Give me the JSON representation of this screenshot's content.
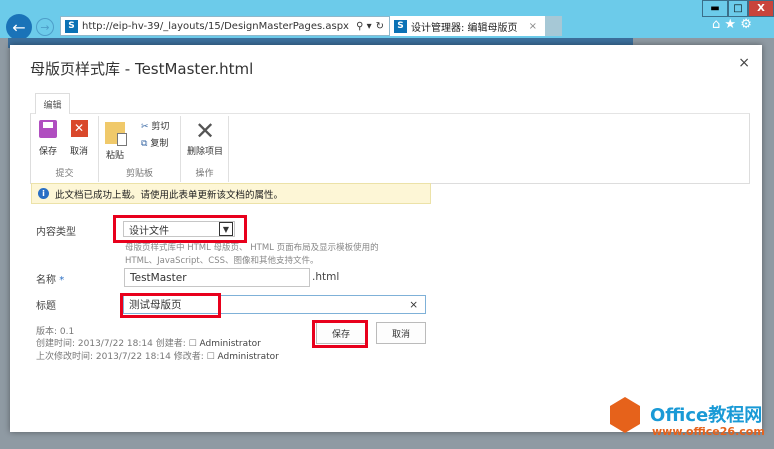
{
  "browser": {
    "url": "http://eip-hv-39/_layouts/15/DesignMasterPages.aspx",
    "url_host": "eip-hv-39",
    "tab_title": "设计管理器: 编辑母版页",
    "window_buttons": {
      "minimize": "▬",
      "maximize": "□",
      "close": "X"
    }
  },
  "dialog": {
    "title": "母版页样式库 - TestMaster.html",
    "close": "×"
  },
  "ribbon": {
    "tab": "编辑",
    "groups": [
      {
        "label": "提交",
        "buttons": [
          "保存",
          "取消"
        ]
      },
      {
        "label": "剪贴板",
        "buttons": [
          "粘贴",
          "剪切",
          "复制"
        ]
      },
      {
        "label": "操作",
        "buttons": [
          "删除项目"
        ]
      }
    ]
  },
  "info": {
    "icon": "i",
    "message": "此文档已成功上载。请使用此表单更新该文档的属性。"
  },
  "form": {
    "content_type": {
      "label": "内容类型",
      "value": "设计文件",
      "desc1": "母版页样式库中 HTML 母版页、 HTML 页面布局及显示模板使用的",
      "desc2": "HTML、JavaScript、CSS、图像和其他支持文件。"
    },
    "name": {
      "label": "名称",
      "required": "*",
      "value": "TestMaster",
      "suffix": ".html"
    },
    "title": {
      "label": "标题",
      "value": "测试母版页",
      "clear": "×"
    },
    "meta": {
      "version": "版本: 0.1",
      "created": "创建时间: 2013/7/22 18:14  创建者:",
      "created_by": "Administrator",
      "modified": "上次修改时间: 2013/7/22 18:14  修改者:",
      "modified_by": "Administrator"
    },
    "save": "保存",
    "cancel": "取消"
  },
  "watermark": {
    "brand": "Office教程网",
    "url": "www.office26.com"
  }
}
